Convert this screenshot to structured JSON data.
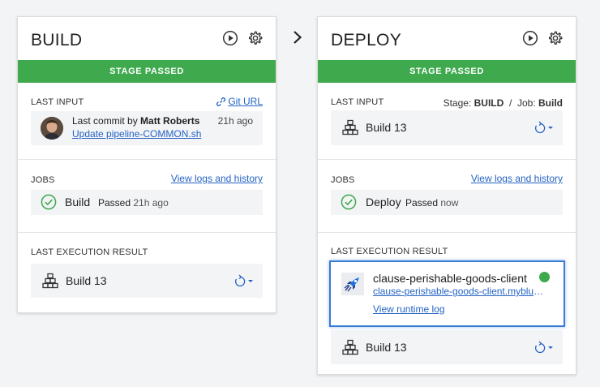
{
  "stages": {
    "build": {
      "title": "BUILD",
      "banner": "STAGE PASSED",
      "last_input": {
        "label": "LAST INPUT",
        "link": "Git URL",
        "commit_prefix": "Last commit by ",
        "author": "Matt Roberts",
        "time": "21h ago",
        "message": "Update pipeline-COMMON.sh"
      },
      "jobs": {
        "label": "JOBS",
        "link": "View logs and history",
        "name": "Build",
        "status": "Passed",
        "time": "21h ago"
      },
      "last_execution": {
        "label": "LAST EXECUTION RESULT",
        "build": "Build 13"
      }
    },
    "deploy": {
      "title": "DEPLOY",
      "banner": "STAGE PASSED",
      "last_input": {
        "label": "LAST INPUT",
        "stage_label": "Stage:",
        "stage_value": "BUILD",
        "separator": "/",
        "job_label": "Job:",
        "job_value": "Build",
        "build": "Build 13"
      },
      "jobs": {
        "label": "JOBS",
        "link": "View logs and history",
        "name": "Deploy",
        "status": "Passed",
        "time": "now"
      },
      "last_execution": {
        "label": "LAST EXECUTION RESULT",
        "app_name": "clause-perishable-goods-client",
        "app_url": "clause-perishable-goods-client.mybluemix.net",
        "runtime_log": "View runtime log",
        "build": "Build 13"
      }
    }
  },
  "colors": {
    "accent_green": "#3ea94d",
    "link_blue": "#2463c5",
    "selection_blue": "#3a7bd5"
  },
  "icons": [
    "play-icon",
    "gear-icon",
    "chevron-right-icon",
    "link-icon",
    "build-stack-icon",
    "redeploy-icon",
    "check-circle-icon",
    "rocket-icon",
    "status-dot"
  ]
}
